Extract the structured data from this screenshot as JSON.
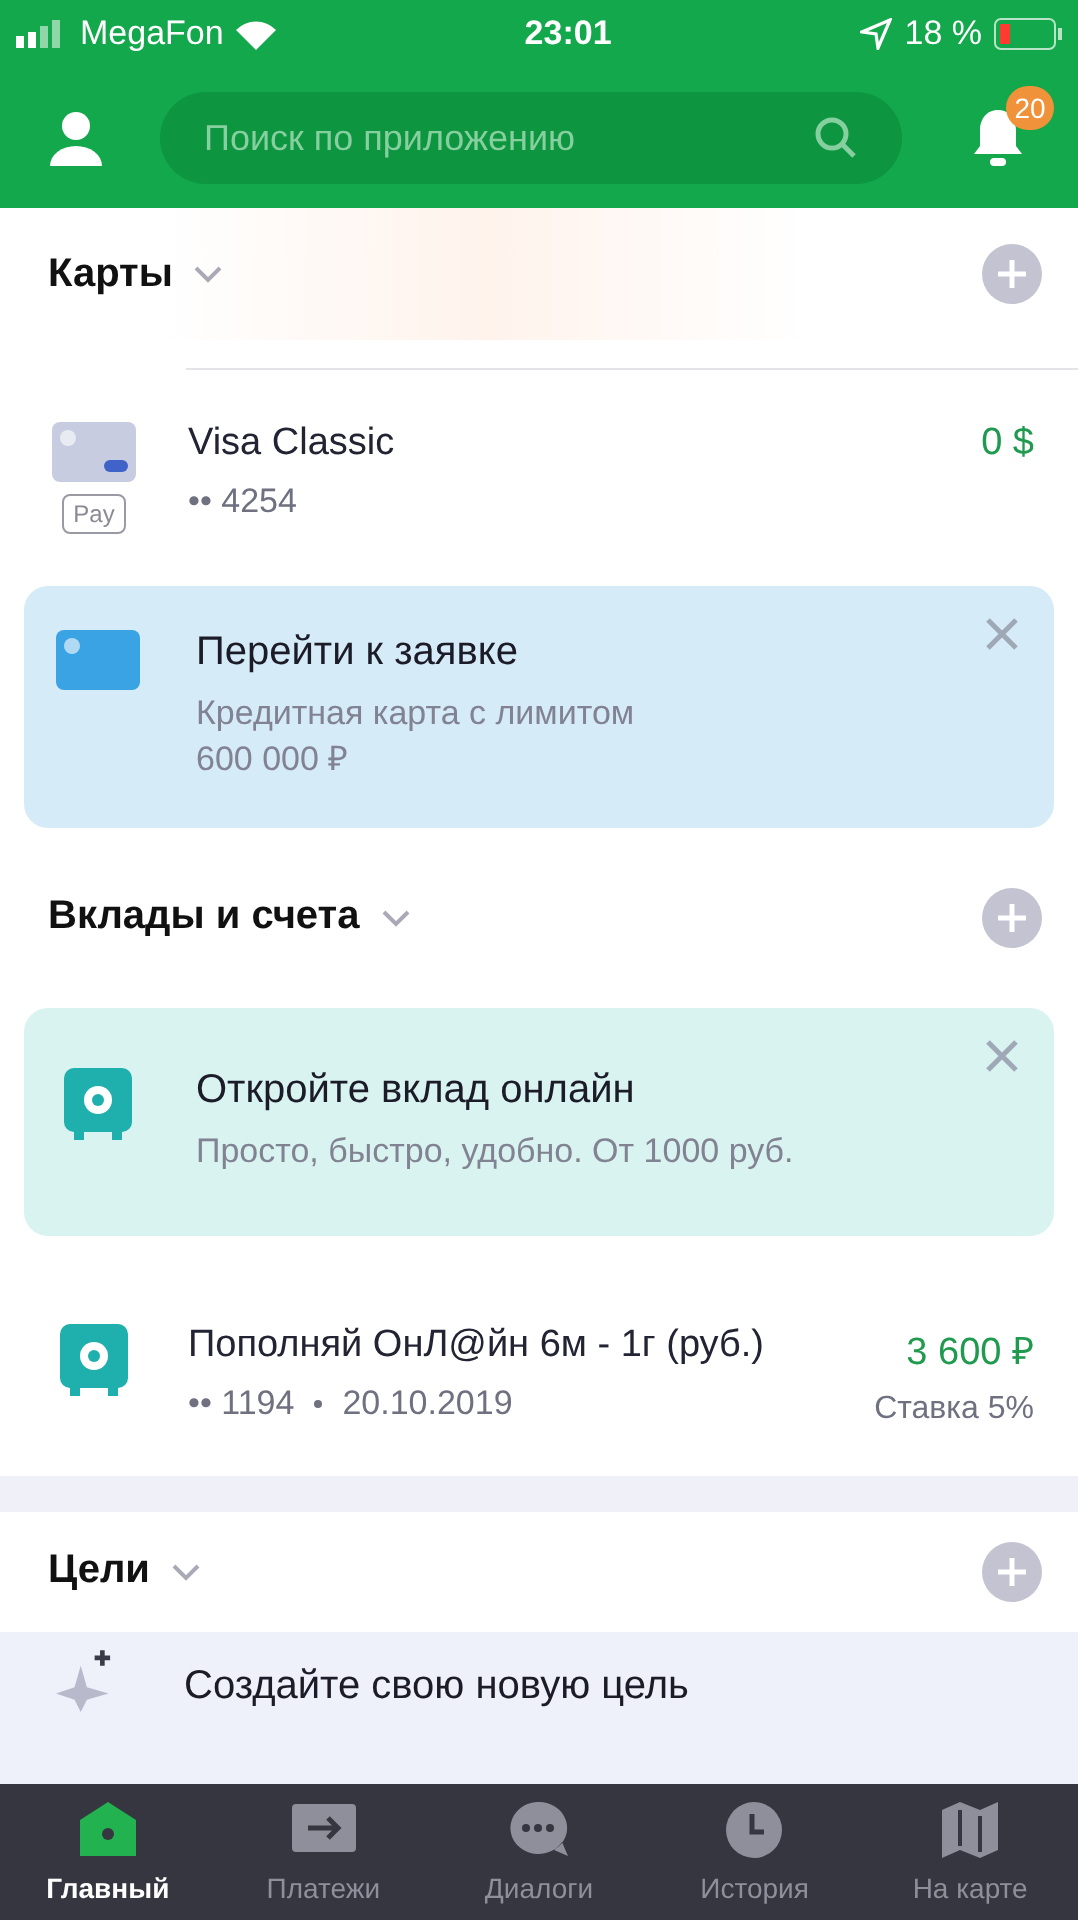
{
  "status_bar": {
    "carrier": "MegaFon",
    "time": "23:01",
    "battery": "18 %"
  },
  "header": {
    "search": {
      "placeholder": "Поиск по приложению"
    },
    "notifications_badge": "20"
  },
  "sections": [
    {
      "title": "Карты",
      "items": [
        {
          "kind": "account",
          "name": "Visa Classic",
          "number": "•• 4254",
          "amount": "0 $",
          "apple_pay": "Pay"
        },
        {
          "kind": "promo",
          "color": "#d6ebf8",
          "title": "Перейти к заявке",
          "text": "Кредитная карта с лимитом 600 000 ₽"
        }
      ]
    },
    {
      "title": "Вклады и счета",
      "items": [
        {
          "kind": "promo",
          "color": "#d9f3f1",
          "title": "Откройте вклад онлайн",
          "text": "Просто, быстро, удобно. От 1000 руб."
        },
        {
          "kind": "deposit",
          "name": "Пополняй ОнЛ@йн 6м - 1г (руб.)",
          "number": "•• 1194",
          "date": "20.10.2019",
          "amount": "3 600 ₽",
          "rate": "Ставка 5%"
        }
      ]
    },
    {
      "title": "Цели",
      "items": [
        {
          "kind": "goal",
          "title": "Создайте свою новую цель"
        }
      ]
    }
  ],
  "tabs": [
    {
      "label": "Главный",
      "selected": true
    },
    {
      "label": "Платежи",
      "selected": false
    },
    {
      "label": "Диалоги",
      "selected": false
    },
    {
      "label": "История",
      "selected": false
    },
    {
      "label": "На карте",
      "selected": false
    }
  ]
}
